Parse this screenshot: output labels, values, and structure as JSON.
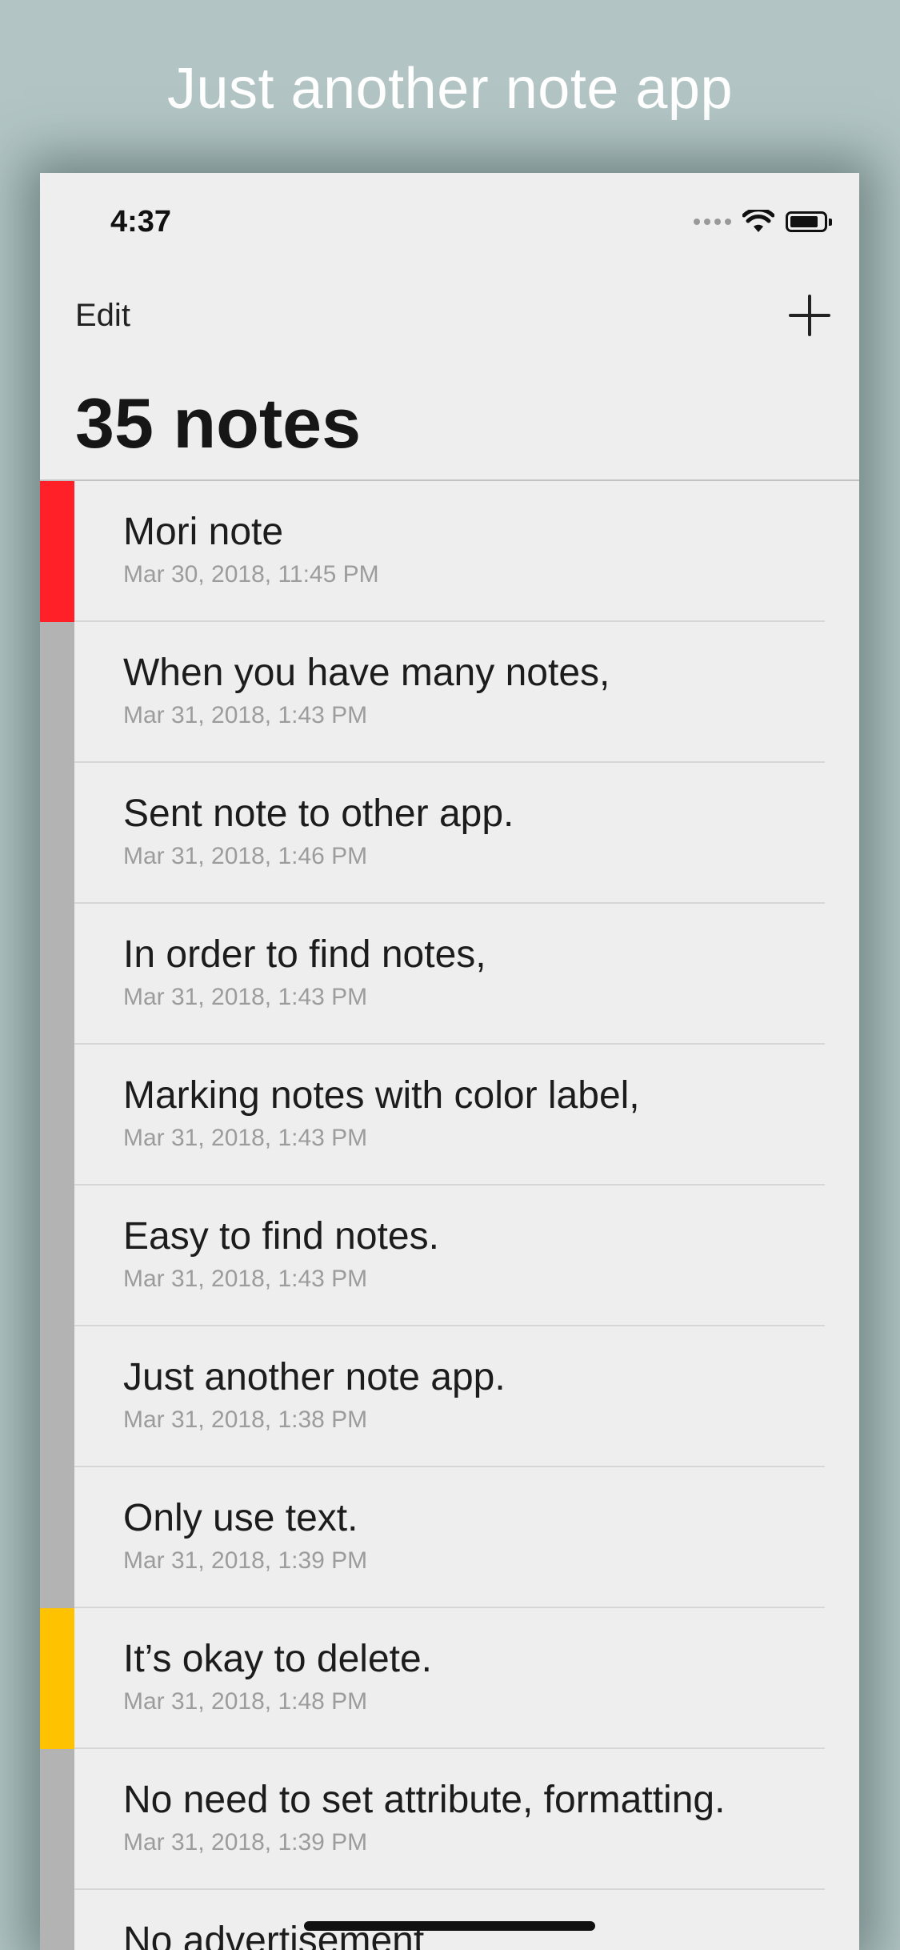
{
  "promo": {
    "title": "Just another note app"
  },
  "status_bar": {
    "time": "4:37"
  },
  "nav": {
    "edit_label": "Edit",
    "add_icon": "plus-icon"
  },
  "header": {
    "title": "35 notes"
  },
  "colors": {
    "background": "#b2c5c4",
    "screen": "#eeeeee",
    "label_red": "#ff2127",
    "label_yellow": "#ffc200",
    "label_gray": "#b3b3b3"
  },
  "notes": [
    {
      "title": "Mori note",
      "date": "Mar 30, 2018, 11:45 PM",
      "label_color": "#ff2127"
    },
    {
      "title": "When you have many notes,",
      "date": "Mar 31, 2018, 1:43 PM",
      "label_color": "#b3b3b3"
    },
    {
      "title": "Sent note to other app.",
      "date": "Mar 31, 2018, 1:46 PM",
      "label_color": "#b3b3b3"
    },
    {
      "title": "In order to find notes,",
      "date": "Mar 31, 2018, 1:43 PM",
      "label_color": "#b3b3b3"
    },
    {
      "title": "Marking notes with color label,",
      "date": "Mar 31, 2018, 1:43 PM",
      "label_color": "#b3b3b3"
    },
    {
      "title": "Easy to find notes.",
      "date": "Mar 31, 2018, 1:43 PM",
      "label_color": "#b3b3b3"
    },
    {
      "title": "Just another note app.",
      "date": "Mar 31, 2018, 1:38 PM",
      "label_color": "#b3b3b3"
    },
    {
      "title": "Only use text.",
      "date": "Mar 31, 2018, 1:39 PM",
      "label_color": "#b3b3b3"
    },
    {
      "title": "It’s okay to delete.",
      "date": "Mar 31, 2018, 1:48 PM",
      "label_color": "#ffc200"
    },
    {
      "title": "No need to set attribute, formatting.",
      "date": "Mar 31, 2018, 1:39 PM",
      "label_color": "#b3b3b3"
    },
    {
      "title": "No advertisement",
      "date": "",
      "label_color": "#b3b3b3"
    }
  ]
}
